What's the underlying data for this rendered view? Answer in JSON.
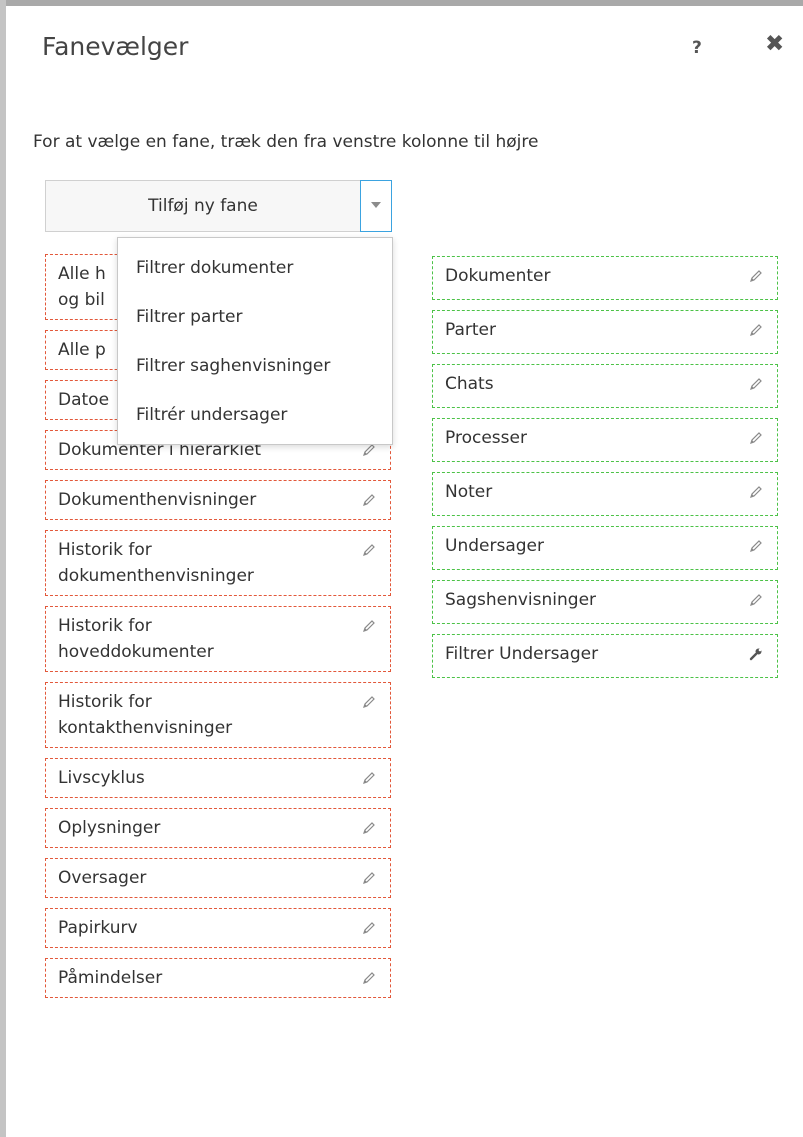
{
  "dialog": {
    "title": "Fanevælger",
    "help_label": "?",
    "close_label": "✖",
    "instructions": "For at vælge en fane, træk den fra venstre kolonne til højre"
  },
  "add_tab": {
    "label": "Tilføj ny fane",
    "menu_open": true,
    "options": [
      "Filtrer dokumenter",
      "Filtrer parter",
      "Filtrer saghenvisninger",
      "Filtrér undersager"
    ]
  },
  "available_tabs": [
    {
      "label": "Alle h",
      "label2": "og bil",
      "icon": "pencil-icon"
    },
    {
      "label": "Alle p",
      "icon": "pencil-icon"
    },
    {
      "label": "Datoe",
      "icon": "pencil-icon"
    },
    {
      "label": "Dokumenter i hierarkiet",
      "icon": "pencil-icon"
    },
    {
      "label": "Dokumenthenvisninger",
      "icon": "pencil-icon"
    },
    {
      "label": "Historik for",
      "label2": "dokumenthenvisninger",
      "icon": "pencil-icon"
    },
    {
      "label": "Historik for",
      "label2": "hoveddokumenter",
      "icon": "pencil-icon"
    },
    {
      "label": "Historik for",
      "label2": "kontakthenvisninger",
      "icon": "pencil-icon"
    },
    {
      "label": "Livscyklus",
      "icon": "pencil-icon"
    },
    {
      "label": "Oplysninger",
      "icon": "pencil-icon"
    },
    {
      "label": "Oversager",
      "icon": "pencil-icon"
    },
    {
      "label": "Papirkurv",
      "icon": "pencil-icon"
    },
    {
      "label": "Påmindelser",
      "icon": "pencil-icon"
    }
  ],
  "selected_tabs": [
    {
      "label": "Dokumenter",
      "icon": "pencil-icon"
    },
    {
      "label": "Parter",
      "icon": "pencil-icon"
    },
    {
      "label": "Chats",
      "icon": "pencil-icon"
    },
    {
      "label": "Processer",
      "icon": "pencil-icon"
    },
    {
      "label": "Noter",
      "icon": "pencil-icon"
    },
    {
      "label": "Undersager",
      "icon": "pencil-icon"
    },
    {
      "label": "Sagshenvisninger",
      "icon": "pencil-icon"
    },
    {
      "label": "Filtrer Undersager",
      "icon": "wrench-icon"
    }
  ],
  "colors": {
    "available_border": "#e2583a",
    "selected_border": "#4cc247",
    "focus_accent": "#3ba3e0"
  }
}
